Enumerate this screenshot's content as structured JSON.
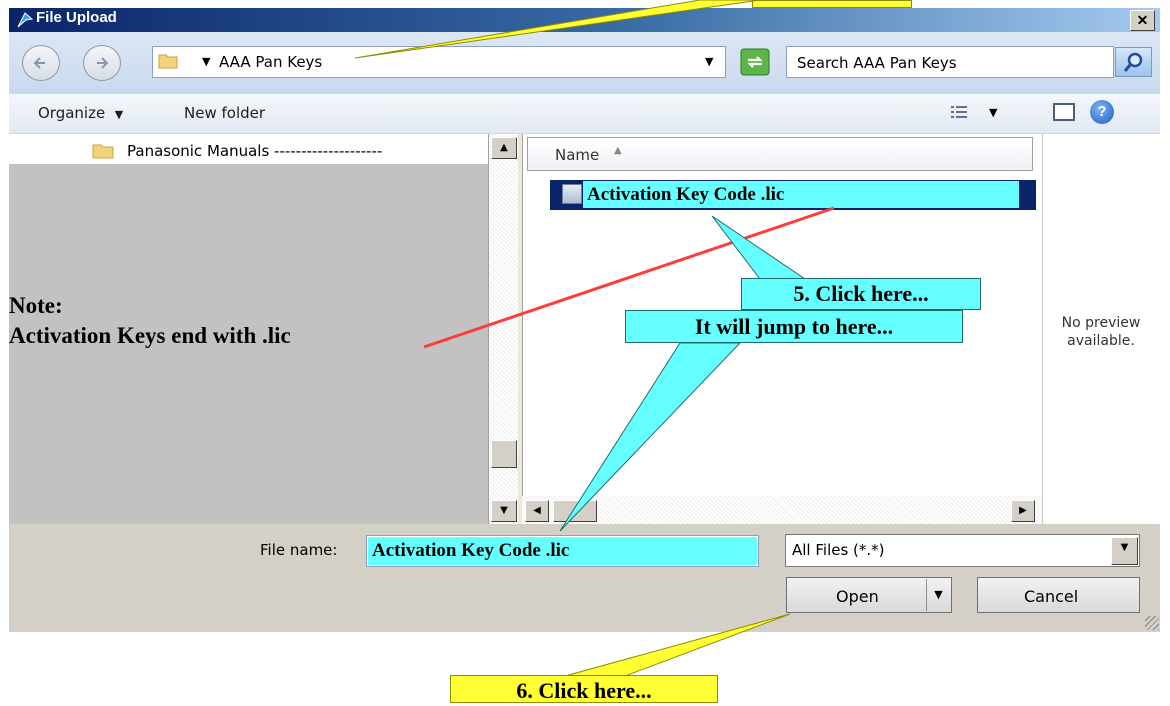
{
  "window": {
    "title": "File Upload",
    "close_label": "✕"
  },
  "nav": {
    "back_icon": "back-arrow-icon",
    "forward_icon": "forward-arrow-icon",
    "address_path": "AAA Pan Keys",
    "search_placeholder": "Search AAA Pan Keys"
  },
  "toolbar": {
    "organize_label": "Organize",
    "new_folder_label": "New folder"
  },
  "tree": {
    "items": [
      {
        "label": "Panasonic Manuals --------------------"
      }
    ]
  },
  "filelist": {
    "column_name": "Name",
    "sort_indicator": "▲",
    "files": [
      {
        "name": "Activation Key Code  .lic",
        "selected": true
      }
    ]
  },
  "preview": {
    "line1": "No preview",
    "line2": "available."
  },
  "bottom": {
    "filename_label": "File name:",
    "filename_value": "Activation Key Code  .lic",
    "filetype_value": "All Files (*.*)",
    "open_label": "Open",
    "cancel_label": "Cancel"
  },
  "annotations": {
    "note_line1": "Note:",
    "note_line2": "Activation Keys end with  .lic",
    "step5": "5. Click here...",
    "jump": "It will jump to here...",
    "step6": "6. Click here..."
  },
  "colors": {
    "callout_cyan": "#66ffff",
    "callout_yellow": "#ffff33",
    "selection": "#0a246a",
    "pointer_red": "#ff3b3b"
  }
}
